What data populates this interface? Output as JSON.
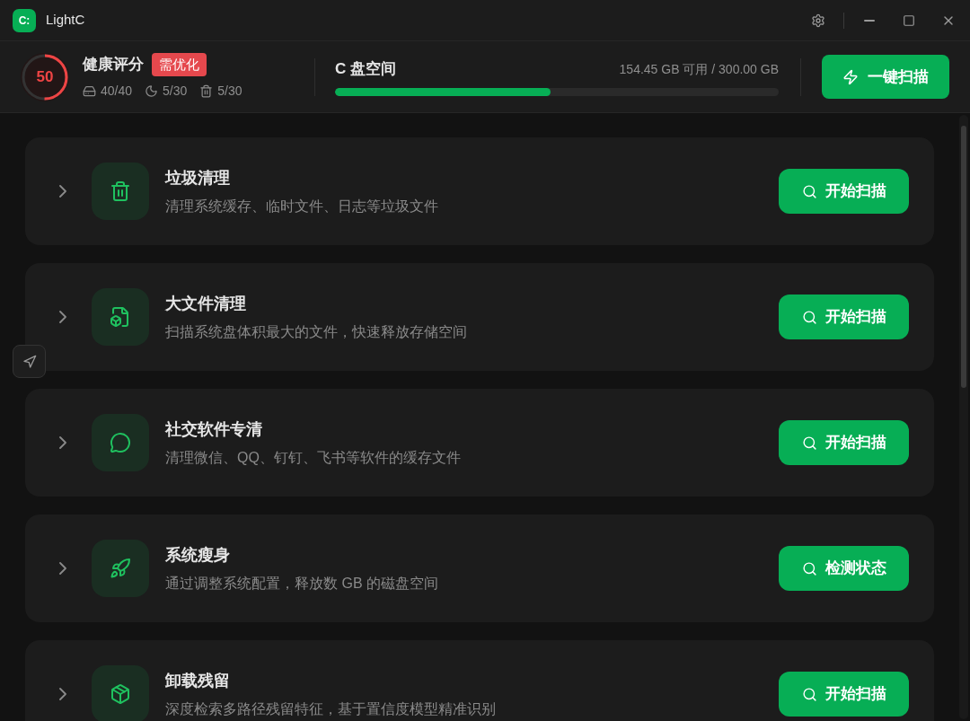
{
  "window": {
    "logo": "C:",
    "title": "LightC"
  },
  "health": {
    "score": "50",
    "level": 0.5,
    "title": "健康评分",
    "badge": "需优化",
    "stats": [
      {
        "kind": "disk",
        "value": "40/40"
      },
      {
        "kind": "sleep",
        "value": "5/30"
      },
      {
        "kind": "trash",
        "value": "5/30"
      }
    ]
  },
  "disk": {
    "title": "C 盘空间",
    "usage": "154.45 GB 可用 / 300.00 GB",
    "level": 0.485
  },
  "scan_all_button": "一键扫描",
  "tools": [
    {
      "kind": "junk",
      "expanded": false,
      "title": "垃圾清理",
      "description": "清理系统缓存、临时文件、日志等垃圾文件",
      "button": "开始扫描"
    },
    {
      "kind": "large_files",
      "expanded": false,
      "title": "大文件清理",
      "description": "扫描系统盘体积最大的文件，快速释放存储空间",
      "button": "开始扫描"
    },
    {
      "kind": "social",
      "expanded": false,
      "title": "社交软件专清",
      "description": "清理微信、QQ、钉钉、飞书等软件的缓存文件",
      "button": "开始扫描"
    },
    {
      "kind": "slim",
      "expanded": false,
      "title": "系统瘦身",
      "description": "通过调整系统配置，释放数 GB 的磁盘空间",
      "button": "检测状态"
    },
    {
      "kind": "uninstall",
      "expanded": false,
      "title": "卸载残留",
      "description": "深度检索多路径残留特征，基于置信度模型精准识别",
      "button": "开始扫描"
    }
  ]
}
